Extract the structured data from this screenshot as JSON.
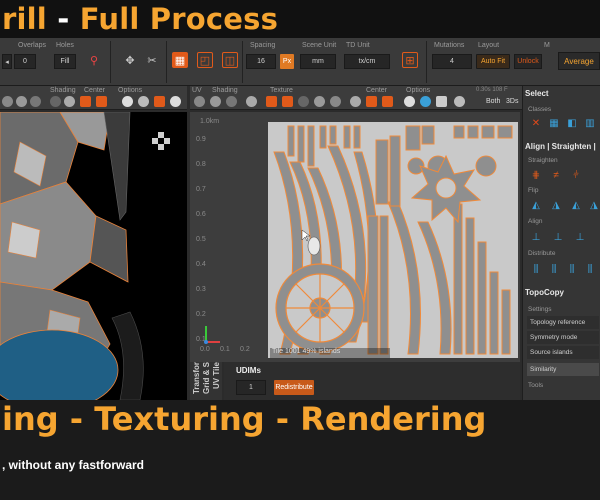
{
  "title": {
    "part1": "rill",
    "dash": " - ",
    "part2": "Full Process"
  },
  "toolbar": {
    "overlaps_label": "Overlaps",
    "holes_label": "Holes",
    "fill_label": "Fill",
    "spacing_label": "Spacing",
    "spacing_value": "16",
    "px_label": "Px",
    "scene_unit_label": "Scene Unit",
    "scene_unit_value": "mm",
    "td_unit_label": "TD Unit",
    "td_unit_value": "tx/cm",
    "mutations_label": "Mutations",
    "mutations_value": "4",
    "layout_label": "Layout",
    "auto_fit_label": "Auto Fit",
    "unlock_label": "Unlock",
    "m_label": "M",
    "average_label": "Average",
    "overlap_value": "0"
  },
  "left_view": {
    "shading_label": "Shading",
    "center_label": "Center",
    "options_label": "Options"
  },
  "uv_view": {
    "uv_label": "UV",
    "shading_label": "Shading",
    "texture_label": "Texture",
    "center_label": "Center",
    "options_label": "Options",
    "both_label": "Both",
    "three_d_label": "3Ds",
    "corner_text": "0.30s 108 F",
    "axis_label": "1.0km",
    "v_ticks": [
      "0.9",
      "0.8",
      "0.7",
      "0.6",
      "0.5",
      "0.4",
      "0.3",
      "0.2",
      "0.1"
    ],
    "u_ticks": [
      "0.0",
      "0.1",
      "0.2"
    ],
    "status_text": "Tile 1001 49% islands"
  },
  "uv_tile": {
    "tab_uv": "UV Tile",
    "tab_grid": "Grid & S",
    "tab_transfer": "Transfor",
    "udims_label": "UDIMs",
    "udim_value": "1",
    "redistribute_label": "Redistribute"
  },
  "right_palette": {
    "select_title": "Select",
    "classes_label": "Classes",
    "align_title": "Align | Straighten |",
    "straighten_label": "Straighten",
    "flip_label": "Flip",
    "align_label": "Align",
    "distribute_label": "Distribute",
    "topocopy_title": "TopoCopy",
    "settings_label": "Settings",
    "rows": [
      "Topology reference",
      "Symmetry mode",
      "Source islands",
      "Similarity"
    ],
    "tools_label": "Tools"
  },
  "bottom": {
    "title": "ing - Texturing - Rendering",
    "subtitle": ", without any fastforward"
  },
  "colors": {
    "accent": "#f6a531",
    "uv_island": "#9a9a9a",
    "uv_outline": "#f08a3a",
    "mesh_blue": "#1f5f85"
  }
}
